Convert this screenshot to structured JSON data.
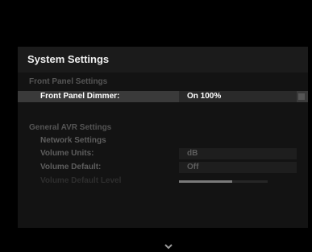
{
  "menu": {
    "title": "System Settings",
    "front_panel_section": "Front Panel Settings",
    "front_panel_dimmer": {
      "label": "Front Panel Dimmer:",
      "value": "On 100%"
    },
    "general_section": "General AVR Settings",
    "network_settings": {
      "label": "Network Settings"
    },
    "volume_units": {
      "label": "Volume Units:",
      "value": "dB"
    },
    "volume_default": {
      "label": "Volume Default:",
      "value": "Off"
    },
    "volume_default_level": {
      "label": "Volume Default Level",
      "level_fraction": 0.6
    },
    "scroll_indicator_icon": "chevron-down-icon"
  },
  "colors": {
    "background": "#000000",
    "panel": "#131313",
    "selected_row": "#3a3a3a",
    "dim_text": "#5e5e5e",
    "section_text": "#555555"
  }
}
